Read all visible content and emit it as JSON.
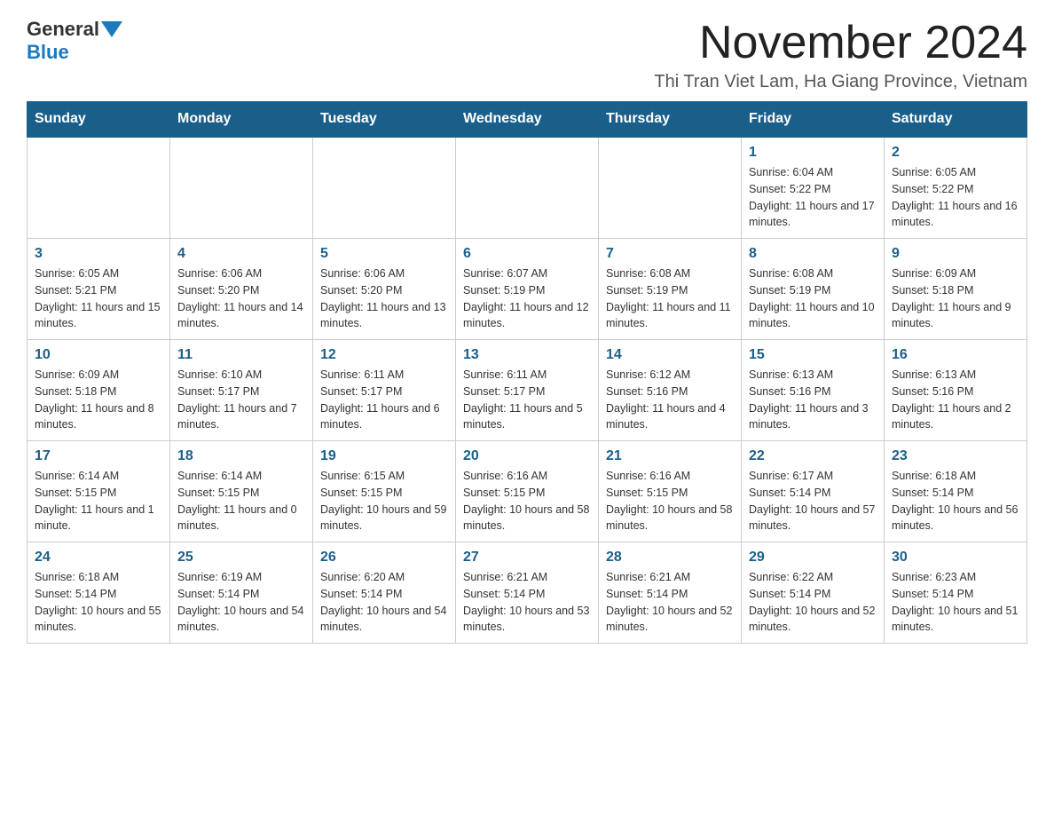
{
  "logo": {
    "general": "General",
    "blue": "Blue"
  },
  "header": {
    "month_title": "November 2024",
    "subtitle": "Thi Tran Viet Lam, Ha Giang Province, Vietnam"
  },
  "weekdays": [
    "Sunday",
    "Monday",
    "Tuesday",
    "Wednesday",
    "Thursday",
    "Friday",
    "Saturday"
  ],
  "weeks": [
    [
      {
        "day": "",
        "info": ""
      },
      {
        "day": "",
        "info": ""
      },
      {
        "day": "",
        "info": ""
      },
      {
        "day": "",
        "info": ""
      },
      {
        "day": "",
        "info": ""
      },
      {
        "day": "1",
        "info": "Sunrise: 6:04 AM\nSunset: 5:22 PM\nDaylight: 11 hours and 17 minutes."
      },
      {
        "day": "2",
        "info": "Sunrise: 6:05 AM\nSunset: 5:22 PM\nDaylight: 11 hours and 16 minutes."
      }
    ],
    [
      {
        "day": "3",
        "info": "Sunrise: 6:05 AM\nSunset: 5:21 PM\nDaylight: 11 hours and 15 minutes."
      },
      {
        "day": "4",
        "info": "Sunrise: 6:06 AM\nSunset: 5:20 PM\nDaylight: 11 hours and 14 minutes."
      },
      {
        "day": "5",
        "info": "Sunrise: 6:06 AM\nSunset: 5:20 PM\nDaylight: 11 hours and 13 minutes."
      },
      {
        "day": "6",
        "info": "Sunrise: 6:07 AM\nSunset: 5:19 PM\nDaylight: 11 hours and 12 minutes."
      },
      {
        "day": "7",
        "info": "Sunrise: 6:08 AM\nSunset: 5:19 PM\nDaylight: 11 hours and 11 minutes."
      },
      {
        "day": "8",
        "info": "Sunrise: 6:08 AM\nSunset: 5:19 PM\nDaylight: 11 hours and 10 minutes."
      },
      {
        "day": "9",
        "info": "Sunrise: 6:09 AM\nSunset: 5:18 PM\nDaylight: 11 hours and 9 minutes."
      }
    ],
    [
      {
        "day": "10",
        "info": "Sunrise: 6:09 AM\nSunset: 5:18 PM\nDaylight: 11 hours and 8 minutes."
      },
      {
        "day": "11",
        "info": "Sunrise: 6:10 AM\nSunset: 5:17 PM\nDaylight: 11 hours and 7 minutes."
      },
      {
        "day": "12",
        "info": "Sunrise: 6:11 AM\nSunset: 5:17 PM\nDaylight: 11 hours and 6 minutes."
      },
      {
        "day": "13",
        "info": "Sunrise: 6:11 AM\nSunset: 5:17 PM\nDaylight: 11 hours and 5 minutes."
      },
      {
        "day": "14",
        "info": "Sunrise: 6:12 AM\nSunset: 5:16 PM\nDaylight: 11 hours and 4 minutes."
      },
      {
        "day": "15",
        "info": "Sunrise: 6:13 AM\nSunset: 5:16 PM\nDaylight: 11 hours and 3 minutes."
      },
      {
        "day": "16",
        "info": "Sunrise: 6:13 AM\nSunset: 5:16 PM\nDaylight: 11 hours and 2 minutes."
      }
    ],
    [
      {
        "day": "17",
        "info": "Sunrise: 6:14 AM\nSunset: 5:15 PM\nDaylight: 11 hours and 1 minute."
      },
      {
        "day": "18",
        "info": "Sunrise: 6:14 AM\nSunset: 5:15 PM\nDaylight: 11 hours and 0 minutes."
      },
      {
        "day": "19",
        "info": "Sunrise: 6:15 AM\nSunset: 5:15 PM\nDaylight: 10 hours and 59 minutes."
      },
      {
        "day": "20",
        "info": "Sunrise: 6:16 AM\nSunset: 5:15 PM\nDaylight: 10 hours and 58 minutes."
      },
      {
        "day": "21",
        "info": "Sunrise: 6:16 AM\nSunset: 5:15 PM\nDaylight: 10 hours and 58 minutes."
      },
      {
        "day": "22",
        "info": "Sunrise: 6:17 AM\nSunset: 5:14 PM\nDaylight: 10 hours and 57 minutes."
      },
      {
        "day": "23",
        "info": "Sunrise: 6:18 AM\nSunset: 5:14 PM\nDaylight: 10 hours and 56 minutes."
      }
    ],
    [
      {
        "day": "24",
        "info": "Sunrise: 6:18 AM\nSunset: 5:14 PM\nDaylight: 10 hours and 55 minutes."
      },
      {
        "day": "25",
        "info": "Sunrise: 6:19 AM\nSunset: 5:14 PM\nDaylight: 10 hours and 54 minutes."
      },
      {
        "day": "26",
        "info": "Sunrise: 6:20 AM\nSunset: 5:14 PM\nDaylight: 10 hours and 54 minutes."
      },
      {
        "day": "27",
        "info": "Sunrise: 6:21 AM\nSunset: 5:14 PM\nDaylight: 10 hours and 53 minutes."
      },
      {
        "day": "28",
        "info": "Sunrise: 6:21 AM\nSunset: 5:14 PM\nDaylight: 10 hours and 52 minutes."
      },
      {
        "day": "29",
        "info": "Sunrise: 6:22 AM\nSunset: 5:14 PM\nDaylight: 10 hours and 52 minutes."
      },
      {
        "day": "30",
        "info": "Sunrise: 6:23 AM\nSunset: 5:14 PM\nDaylight: 10 hours and 51 minutes."
      }
    ]
  ]
}
